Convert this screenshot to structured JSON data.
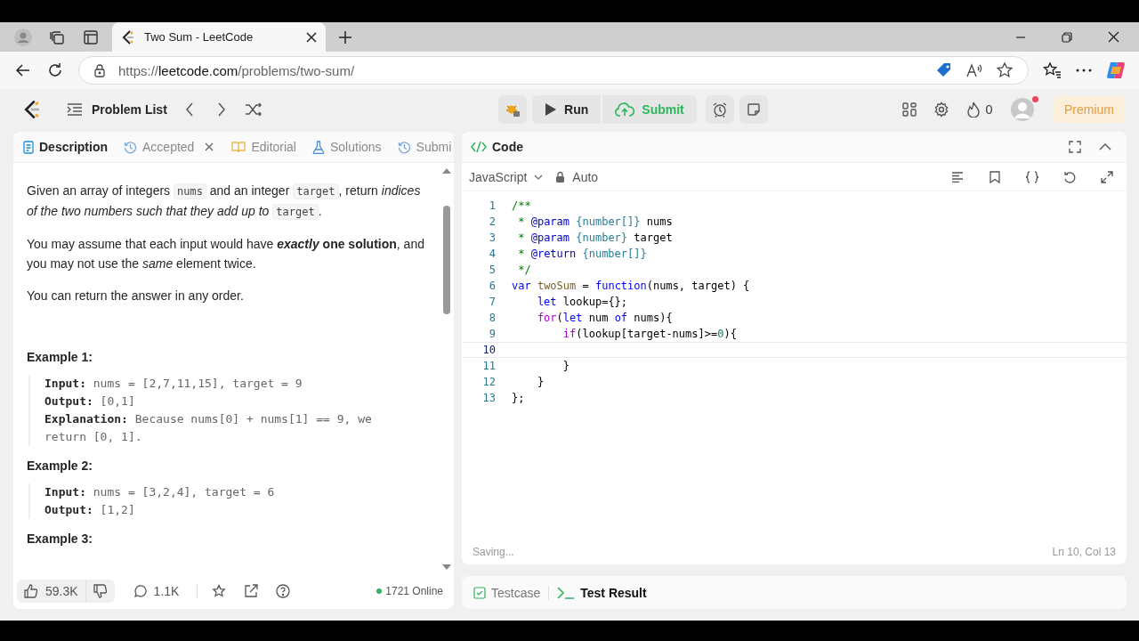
{
  "browser": {
    "tab_title": "Two Sum - LeetCode",
    "url": {
      "scheme": "https://",
      "domain": "leetcode.com",
      "path": "/problems/two-sum/"
    }
  },
  "header": {
    "problem_list": "Problem List",
    "run": "Run",
    "submit": "Submit",
    "streak": "0",
    "premium": "Premium",
    "notification": true
  },
  "description_tabs": [
    {
      "label": "Description",
      "kind": "doc",
      "selected": true,
      "closable": false
    },
    {
      "label": "Accepted",
      "kind": "history",
      "selected": false,
      "closable": true
    },
    {
      "label": "Editorial",
      "kind": "book",
      "selected": false,
      "closable": false
    },
    {
      "label": "Solutions",
      "kind": "flask",
      "selected": false,
      "closable": false
    },
    {
      "label": "Submi",
      "kind": "history",
      "selected": false,
      "closable": false
    }
  ],
  "description": [
    [
      {
        "kind": "plain",
        "t": "Given an array of integers "
      },
      {
        "kind": "code",
        "t": "nums"
      },
      {
        "kind": "plain",
        "t": " and an integer "
      },
      {
        "kind": "code",
        "t": "target"
      },
      {
        "kind": "plain",
        "t": ", return "
      },
      {
        "kind": "italic",
        "t": "indices of the two numbers such that they add up to "
      },
      {
        "kind": "code",
        "t": "target"
      },
      {
        "kind": "plain",
        "t": "."
      }
    ],
    [
      {
        "kind": "plain",
        "t": "You may assume that each input would have "
      },
      {
        "kind": "bolditalic",
        "t": "exactly"
      },
      {
        "kind": "bold",
        "t": " one solution"
      },
      {
        "kind": "plain",
        "t": ", and you may not use the "
      },
      {
        "kind": "italic",
        "t": "same"
      },
      {
        "kind": "plain",
        "t": " element twice."
      }
    ],
    [
      {
        "kind": "plain",
        "t": "You can return the answer in any order."
      }
    ]
  ],
  "examples": [
    {
      "title": "Example 1:",
      "lines": [
        {
          "label": "Input:",
          "value": "nums = [2,7,11,15], target = 9"
        },
        {
          "label": "Output:",
          "value": "[0,1]"
        },
        {
          "label": "Explanation:",
          "value": "Because nums[0] + nums[1] == 9, we return [0, 1]."
        }
      ]
    },
    {
      "title": "Example 2:",
      "lines": [
        {
          "label": "Input:",
          "value": "nums = [3,2,4], target = 6"
        },
        {
          "label": "Output:",
          "value": "[1,2]"
        }
      ]
    },
    {
      "title": "Example 3:"
    }
  ],
  "footer": {
    "likes": "59.3K",
    "comments": "1.1K",
    "online": "1721 Online"
  },
  "code_panel": {
    "title": "Code",
    "language": "JavaScript",
    "mode": "Auto",
    "status": "Saving...",
    "position": "Ln 10, Col 13"
  },
  "code_lines": [
    {
      "number": "1",
      "current": false,
      "tokens": [
        {
          "kind": "cm",
          "t": "/**"
        }
      ]
    },
    {
      "number": "2",
      "current": false,
      "tokens": [
        {
          "kind": "cm",
          "t": " *"
        },
        {
          "kind": "tag",
          "t": " @param"
        },
        {
          "kind": "type",
          "t": " {number[]}"
        },
        {
          "kind": "plain",
          "t": " nums"
        }
      ]
    },
    {
      "number": "3",
      "current": false,
      "tokens": [
        {
          "kind": "cm",
          "t": " *"
        },
        {
          "kind": "tag",
          "t": " @param"
        },
        {
          "kind": "type",
          "t": " {number}"
        },
        {
          "kind": "plain",
          "t": " target"
        }
      ]
    },
    {
      "number": "4",
      "current": false,
      "tokens": [
        {
          "kind": "cm",
          "t": " *"
        },
        {
          "kind": "tag",
          "t": " @return"
        },
        {
          "kind": "type",
          "t": " {number[]}"
        }
      ]
    },
    {
      "number": "5",
      "current": false,
      "tokens": [
        {
          "kind": "cm",
          "t": " */"
        }
      ]
    },
    {
      "number": "6",
      "current": false,
      "tokens": [
        {
          "kind": "kw",
          "t": "var"
        },
        {
          "kind": "fn",
          "t": " twoSum"
        },
        {
          "kind": "plain",
          "t": " = "
        },
        {
          "kind": "kw",
          "t": "function"
        },
        {
          "kind": "plain",
          "t": "(nums, target) {"
        }
      ]
    },
    {
      "number": "7",
      "current": false,
      "tokens": [
        {
          "kind": "kw",
          "t": "    let"
        },
        {
          "kind": "plain",
          "t": " lookup={};"
        }
      ]
    },
    {
      "number": "8",
      "current": false,
      "tokens": [
        {
          "kind": "ctl",
          "t": "    for"
        },
        {
          "kind": "plain",
          "t": "("
        },
        {
          "kind": "kw",
          "t": "let"
        },
        {
          "kind": "plain",
          "t": " num "
        },
        {
          "kind": "kw",
          "t": "of"
        },
        {
          "kind": "plain",
          "t": " nums){"
        }
      ]
    },
    {
      "number": "9",
      "current": false,
      "tokens": [
        {
          "kind": "ctl",
          "t": "        if"
        },
        {
          "kind": "plain",
          "t": "(lookup[target-nums]>="
        },
        {
          "kind": "num",
          "t": "0"
        },
        {
          "kind": "plain",
          "t": "){"
        }
      ]
    },
    {
      "number": "10",
      "current": true
    },
    {
      "number": "11",
      "current": false,
      "tokens": [
        {
          "kind": "plain",
          "t": "        }"
        }
      ]
    },
    {
      "number": "12",
      "current": false,
      "tokens": [
        {
          "kind": "plain",
          "t": "    }"
        }
      ]
    },
    {
      "number": "13",
      "current": false,
      "tokens": [
        {
          "kind": "plain",
          "t": "};"
        }
      ]
    }
  ],
  "bottom_tabs": [
    {
      "label": "Testcase",
      "kind": "check",
      "selected": false
    },
    {
      "label": "Test Result",
      "kind": "terminal",
      "selected": true
    }
  ]
}
